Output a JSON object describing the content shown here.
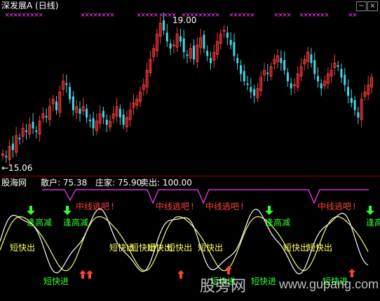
{
  "main": {
    "title": "深发展A (日线)",
    "high_label": "19.00",
    "low_label": "←15.06",
    "minimize": "−",
    "close": "×"
  },
  "indicator": {
    "name": "股海网",
    "sanhu": "散户: 75.38",
    "zhuangjia": "庄家: 75.90",
    "maichu": "卖出: 100.00"
  },
  "signals": {
    "escape": "中线逃吧",
    "reduce": "逢高减",
    "short_out": "短快出",
    "short_in": "短快进"
  },
  "watermark": {
    "brand": "股旁网",
    "url": "www.gupang.com"
  },
  "colors": {
    "up": "#ff3b3b",
    "down": "#3fd8e8",
    "magenta": "#ff40ff",
    "white_line": "#ffffff",
    "yellow_line": "#ffff66",
    "green_sig": "#33ff33",
    "red_sig": "#ff4040"
  },
  "chart_data": {
    "type": "candlestick",
    "price_high": 19.0,
    "price_low": 15.06,
    "indicator_values": {
      "sanhu": 75.38,
      "zhuangjia": 75.9,
      "maichu": 100.0
    }
  }
}
